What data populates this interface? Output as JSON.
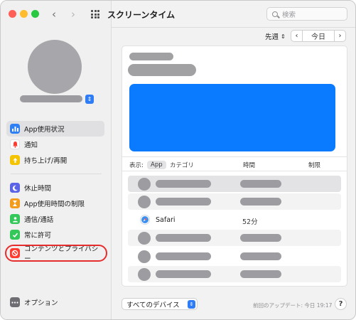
{
  "window": {
    "title": "スクリーンタイム",
    "back_arrow": "‹",
    "forward_arrow": "›",
    "traffic_lights": [
      "#ff5f57",
      "#febc2e",
      "#28c840"
    ]
  },
  "search": {
    "placeholder": "検索"
  },
  "user": {
    "stepper_glyph": "⇕"
  },
  "sidebar": {
    "items": [
      {
        "label": "App使用状況",
        "icon": "bar-chart-icon",
        "color": "#2f7ff5",
        "glyph": "▮"
      },
      {
        "label": "通知",
        "icon": "bell-icon",
        "color": "#ffffff",
        "glyph": "🔔"
      },
      {
        "label": "持ち上げ/再開",
        "icon": "pickup-icon",
        "color": "#f5c400",
        "glyph": "↑"
      },
      {
        "label": "休止時間",
        "icon": "moon-icon",
        "color": "#5b63e6",
        "glyph": "☾"
      },
      {
        "label": "App使用時間の制限",
        "icon": "hourglass-icon",
        "color": "#f29b1c",
        "glyph": "⧗"
      },
      {
        "label": "通信/通話",
        "icon": "contacts-icon",
        "color": "#34c759",
        "glyph": "●"
      },
      {
        "label": "常に許可",
        "icon": "checkmark-icon",
        "color": "#34c759",
        "glyph": "✓"
      },
      {
        "label": "コンテンツとプライバシー",
        "icon": "prohibited-icon",
        "color": "#ff3b30",
        "glyph": "⊘"
      }
    ],
    "options": {
      "label": "オプション",
      "icon": "ellipsis-icon",
      "color": "#6e6e73",
      "glyph": "•••"
    }
  },
  "toolbar": {
    "period_label": "先週",
    "period_chevron": "⇕",
    "prev_glyph": "‹",
    "today_label": "今日",
    "next_glyph": "›"
  },
  "filter": {
    "show_label": "表示:",
    "tab_app": "App",
    "tab_category": "カテゴリ",
    "col_time": "時間",
    "col_limit": "制限"
  },
  "rows": {
    "safari": {
      "app": "Safari",
      "time": "52分"
    }
  },
  "footer": {
    "device_select": "すべてのデバイス",
    "device_stepper_glyph": "⇕",
    "last_updated": "前回のアップデート: 今日 19:17",
    "help_label": "?"
  }
}
